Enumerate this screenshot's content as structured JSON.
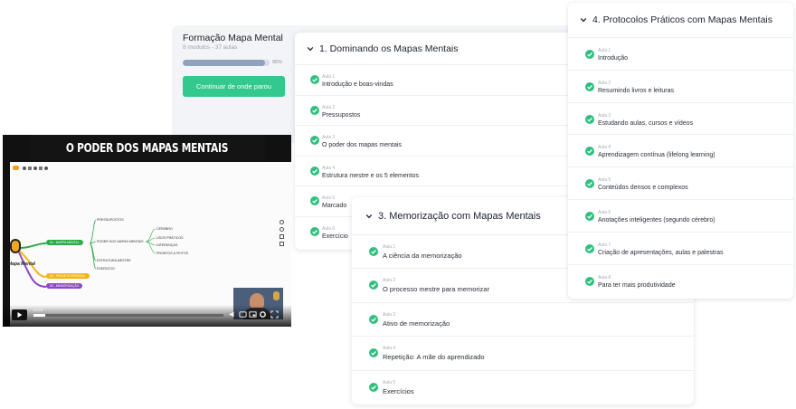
{
  "course": {
    "title": "Formação Mapa Mental",
    "subtitle": "8 modulos - 37 aulas",
    "progress_percent": 95,
    "progress_label": "95%",
    "continue_label": "Continuar de onde parou"
  },
  "modules": [
    {
      "title": "1. Dominando os Mapas Mentais",
      "lessons": [
        {
          "num": "Aula 1",
          "title": "Introdução e boas-vindas"
        },
        {
          "num": "Aula 2",
          "title": "Pressupostos"
        },
        {
          "num": "Aula 3",
          "title": "O poder dos mapas mentais"
        },
        {
          "num": "Aula 4",
          "title": "Estrutura mestre e os 5 elementos"
        },
        {
          "num": "Aula 5",
          "title": "Marcado"
        },
        {
          "num": "Aula 6",
          "title": "Exercício"
        }
      ]
    },
    {
      "title": "3. Memorização com Mapas Mentais",
      "lessons": [
        {
          "num": "Aula 1",
          "title": "A ciência da memorização"
        },
        {
          "num": "Aula 2",
          "title": "O processo mestre para memorizar"
        },
        {
          "num": "Aula 3",
          "title": "Ativo de memorização"
        },
        {
          "num": "Aula 4",
          "title": "Repetição: A mãe do aprendizado"
        },
        {
          "num": "Aula 5",
          "title": "Exercícios"
        }
      ]
    },
    {
      "title": "4. Protocolos Práticos com Mapas Mentais",
      "lessons": [
        {
          "num": "Aula 1",
          "title": "Introdução"
        },
        {
          "num": "Aula 2",
          "title": "Resumindo livros e leituras"
        },
        {
          "num": "Aula 3",
          "title": "Estudando aulas, cursos e vídeos"
        },
        {
          "num": "Aula 4",
          "title": "Aprendizagem contínua (lifelong learning)"
        },
        {
          "num": "Aula 5",
          "title": "Conteúdos densos e complexos"
        },
        {
          "num": "Aula 6",
          "title": "Anotações inteligentes (segundo cérebro)"
        },
        {
          "num": "Aula 7",
          "title": "Criação de apresentações, aulas e palestras"
        },
        {
          "num": "Aula 8",
          "title": "Para ter mais produtividade"
        }
      ]
    }
  ],
  "video": {
    "banner": "O PODER DOS MAPAS MENTAIS",
    "time": "01:16",
    "progress_fraction": 0.06,
    "mindmap": {
      "center": "Mapa Mental",
      "branches": [
        {
          "label": "#1 - MAPPA MENTAL",
          "color": "#2eaa4a"
        },
        {
          "label": "#2 - PROJETO PESSOAL",
          "color": "#f2b418"
        },
        {
          "label": "#3 - MEMORIZAÇÃO",
          "color": "#8e47c2"
        }
      ],
      "sub": [
        "PRESSUPOSTOS",
        "PODER DOS MAPAS MENTAIS",
        "ESTRUTURA MESTRE",
        "EXERCÍCIO"
      ],
      "leaves": [
        "CÉREBRO",
        "USOS PRÁTICOS",
        "DIFERENÇAS",
        "PRONTOS & FEITOS"
      ]
    }
  },
  "colors": {
    "accent": "#34c98c",
    "check": "#2fbf7e"
  }
}
